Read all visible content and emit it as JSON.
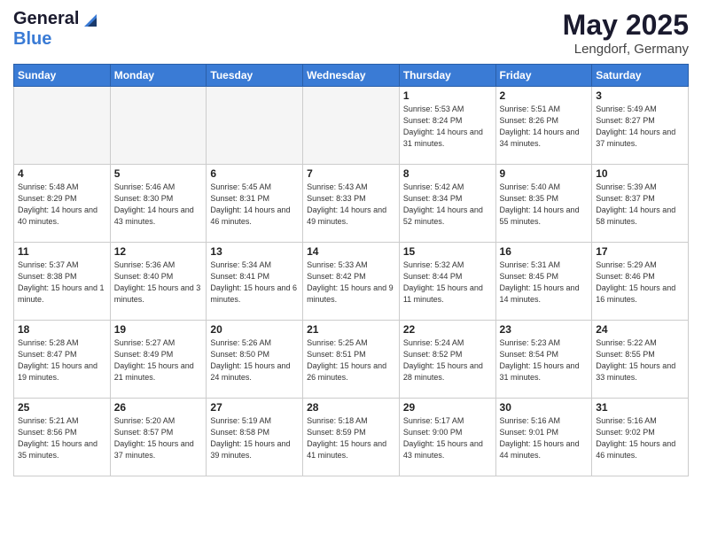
{
  "header": {
    "logo_general": "General",
    "logo_blue": "Blue",
    "month_title": "May 2025",
    "location": "Lengdorf, Germany"
  },
  "days_of_week": [
    "Sunday",
    "Monday",
    "Tuesday",
    "Wednesday",
    "Thursday",
    "Friday",
    "Saturday"
  ],
  "weeks": [
    [
      {
        "day": "",
        "empty": true
      },
      {
        "day": "",
        "empty": true
      },
      {
        "day": "",
        "empty": true
      },
      {
        "day": "",
        "empty": true
      },
      {
        "day": "1",
        "sunrise": "5:53 AM",
        "sunset": "8:24 PM",
        "daylight": "14 hours and 31 minutes."
      },
      {
        "day": "2",
        "sunrise": "5:51 AM",
        "sunset": "8:26 PM",
        "daylight": "14 hours and 34 minutes."
      },
      {
        "day": "3",
        "sunrise": "5:49 AM",
        "sunset": "8:27 PM",
        "daylight": "14 hours and 37 minutes."
      }
    ],
    [
      {
        "day": "4",
        "sunrise": "5:48 AM",
        "sunset": "8:29 PM",
        "daylight": "14 hours and 40 minutes."
      },
      {
        "day": "5",
        "sunrise": "5:46 AM",
        "sunset": "8:30 PM",
        "daylight": "14 hours and 43 minutes."
      },
      {
        "day": "6",
        "sunrise": "5:45 AM",
        "sunset": "8:31 PM",
        "daylight": "14 hours and 46 minutes."
      },
      {
        "day": "7",
        "sunrise": "5:43 AM",
        "sunset": "8:33 PM",
        "daylight": "14 hours and 49 minutes."
      },
      {
        "day": "8",
        "sunrise": "5:42 AM",
        "sunset": "8:34 PM",
        "daylight": "14 hours and 52 minutes."
      },
      {
        "day": "9",
        "sunrise": "5:40 AM",
        "sunset": "8:35 PM",
        "daylight": "14 hours and 55 minutes."
      },
      {
        "day": "10",
        "sunrise": "5:39 AM",
        "sunset": "8:37 PM",
        "daylight": "14 hours and 58 minutes."
      }
    ],
    [
      {
        "day": "11",
        "sunrise": "5:37 AM",
        "sunset": "8:38 PM",
        "daylight": "15 hours and 1 minute."
      },
      {
        "day": "12",
        "sunrise": "5:36 AM",
        "sunset": "8:40 PM",
        "daylight": "15 hours and 3 minutes."
      },
      {
        "day": "13",
        "sunrise": "5:34 AM",
        "sunset": "8:41 PM",
        "daylight": "15 hours and 6 minutes."
      },
      {
        "day": "14",
        "sunrise": "5:33 AM",
        "sunset": "8:42 PM",
        "daylight": "15 hours and 9 minutes."
      },
      {
        "day": "15",
        "sunrise": "5:32 AM",
        "sunset": "8:44 PM",
        "daylight": "15 hours and 11 minutes."
      },
      {
        "day": "16",
        "sunrise": "5:31 AM",
        "sunset": "8:45 PM",
        "daylight": "15 hours and 14 minutes."
      },
      {
        "day": "17",
        "sunrise": "5:29 AM",
        "sunset": "8:46 PM",
        "daylight": "15 hours and 16 minutes."
      }
    ],
    [
      {
        "day": "18",
        "sunrise": "5:28 AM",
        "sunset": "8:47 PM",
        "daylight": "15 hours and 19 minutes."
      },
      {
        "day": "19",
        "sunrise": "5:27 AM",
        "sunset": "8:49 PM",
        "daylight": "15 hours and 21 minutes."
      },
      {
        "day": "20",
        "sunrise": "5:26 AM",
        "sunset": "8:50 PM",
        "daylight": "15 hours and 24 minutes."
      },
      {
        "day": "21",
        "sunrise": "5:25 AM",
        "sunset": "8:51 PM",
        "daylight": "15 hours and 26 minutes."
      },
      {
        "day": "22",
        "sunrise": "5:24 AM",
        "sunset": "8:52 PM",
        "daylight": "15 hours and 28 minutes."
      },
      {
        "day": "23",
        "sunrise": "5:23 AM",
        "sunset": "8:54 PM",
        "daylight": "15 hours and 31 minutes."
      },
      {
        "day": "24",
        "sunrise": "5:22 AM",
        "sunset": "8:55 PM",
        "daylight": "15 hours and 33 minutes."
      }
    ],
    [
      {
        "day": "25",
        "sunrise": "5:21 AM",
        "sunset": "8:56 PM",
        "daylight": "15 hours and 35 minutes."
      },
      {
        "day": "26",
        "sunrise": "5:20 AM",
        "sunset": "8:57 PM",
        "daylight": "15 hours and 37 minutes."
      },
      {
        "day": "27",
        "sunrise": "5:19 AM",
        "sunset": "8:58 PM",
        "daylight": "15 hours and 39 minutes."
      },
      {
        "day": "28",
        "sunrise": "5:18 AM",
        "sunset": "8:59 PM",
        "daylight": "15 hours and 41 minutes."
      },
      {
        "day": "29",
        "sunrise": "5:17 AM",
        "sunset": "9:00 PM",
        "daylight": "15 hours and 43 minutes."
      },
      {
        "day": "30",
        "sunrise": "5:16 AM",
        "sunset": "9:01 PM",
        "daylight": "15 hours and 44 minutes."
      },
      {
        "day": "31",
        "sunrise": "5:16 AM",
        "sunset": "9:02 PM",
        "daylight": "15 hours and 46 minutes."
      }
    ]
  ]
}
